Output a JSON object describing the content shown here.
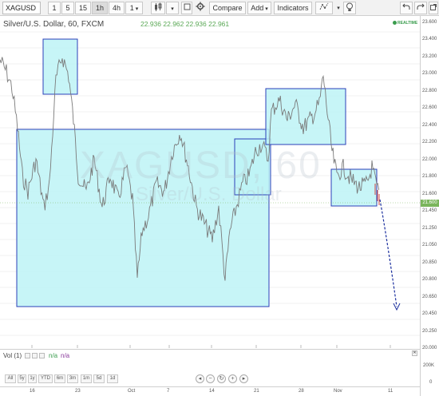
{
  "toolbar": {
    "symbol": "XAGUSD",
    "intervals": [
      "1",
      "5",
      "15",
      "1h",
      "4h",
      "1"
    ],
    "active_interval": "1h",
    "compare_label": "Compare",
    "add_label": "Add",
    "indicators_label": "Indicators"
  },
  "legend": {
    "title": "Silver/U.S. Dollar, 60, FXCM",
    "open": "22.936",
    "high": "22.962",
    "low": "22.936",
    "close": "22.961",
    "realtime": "REALTIME"
  },
  "watermark": {
    "symbol": "XAGUSD, 60",
    "description": "Silver/U.S. Dollar"
  },
  "price_axis": {
    "labels": [
      "23.600",
      "23.400",
      "23.200",
      "23.000",
      "22.800",
      "22.600",
      "22.400",
      "22.200",
      "22.000",
      "21.800",
      "21.600",
      "21.450",
      "21.250",
      "21.050",
      "20.850",
      "20.800",
      "20.650",
      "20.450",
      "20.250",
      "20.000"
    ],
    "last_price": "21.600",
    "last_color": "#7ab55c"
  },
  "volume": {
    "label": "Vol (1)",
    "na1": "n/a",
    "na2": "n/a",
    "ticks": [
      "200K",
      "0"
    ]
  },
  "range_buttons": [
    "All",
    "5y",
    "1y",
    "YTD",
    "6m",
    "3m",
    "1m",
    "5d",
    "1d"
  ],
  "time_axis": [
    "16",
    "23",
    "Oct",
    "7",
    "14",
    "21",
    "28",
    "Nov",
    "11"
  ],
  "colors": {
    "box_fill": "#bdf3f6",
    "box_stroke": "#2b3fb8",
    "arrow": "#1b2f9e",
    "candles": "#7a7a7a"
  }
}
